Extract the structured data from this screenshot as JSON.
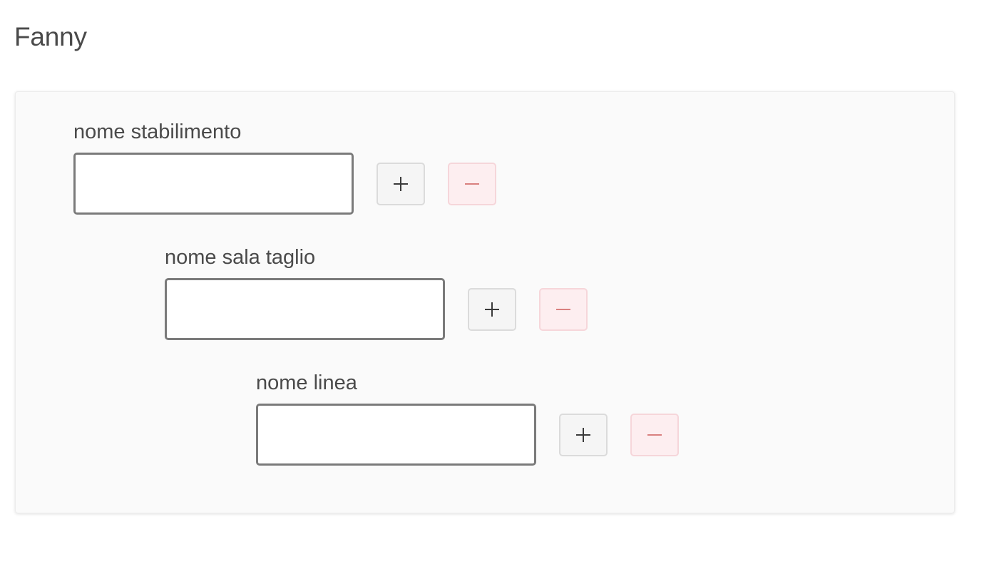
{
  "page": {
    "title": "Fanny"
  },
  "colors": {
    "text": "#4a4a4a",
    "card_background": "#fafafa",
    "add_button_bg": "#f5f5f5",
    "remove_button_bg": "#fdeef0",
    "remove_icon": "#d9807f",
    "add_icon": "#3a3a3a",
    "input_border": "#7a7a7a"
  },
  "form": {
    "levels": [
      {
        "label": "nome stabilimento",
        "value": "",
        "add_icon": "plus-icon",
        "remove_icon": "minus-icon"
      },
      {
        "label": "nome sala taglio",
        "value": "",
        "add_icon": "plus-icon",
        "remove_icon": "minus-icon"
      },
      {
        "label": "nome linea",
        "value": "",
        "add_icon": "plus-icon",
        "remove_icon": "minus-icon"
      }
    ]
  }
}
